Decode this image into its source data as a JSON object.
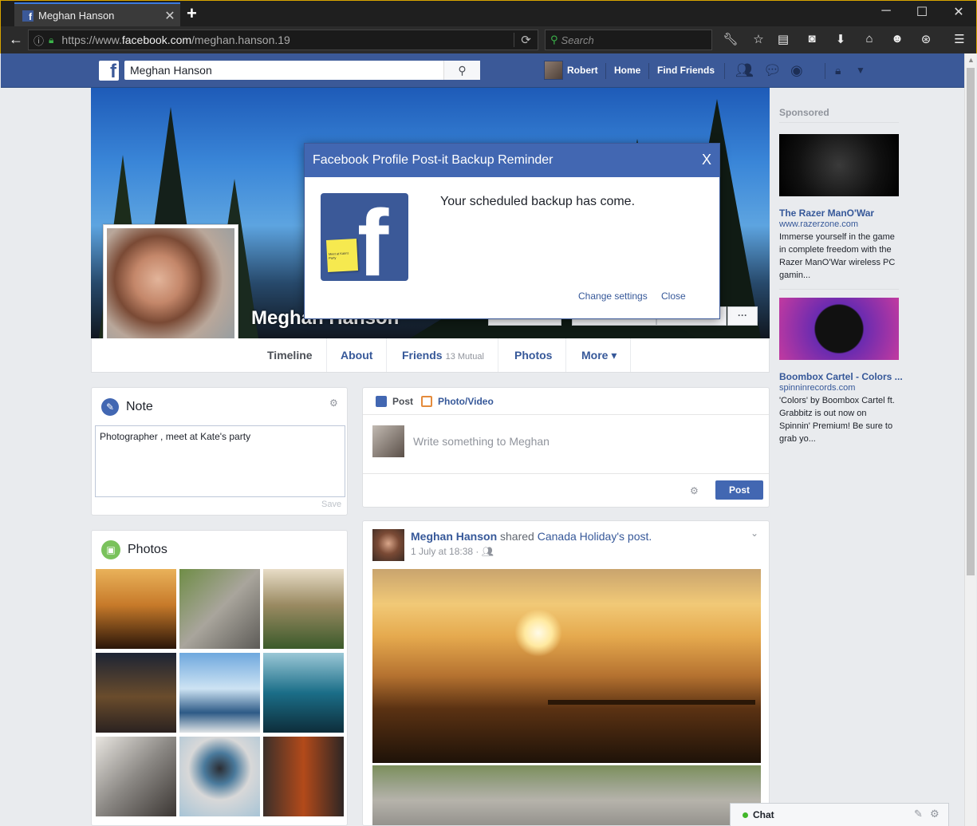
{
  "browser": {
    "tab_title": "Meghan Hanson",
    "new_tab_icon": "plus-icon",
    "url_prefix": "https://www.",
    "url_domain": "facebook.com",
    "url_path": "/meghan.hanson.19",
    "search_placeholder": "Search"
  },
  "fb": {
    "logo": "f",
    "search_value": "Meghan Hanson",
    "user_name": "Robert",
    "nav": [
      "Home",
      "Find Friends"
    ],
    "brand_color": "#3b5998"
  },
  "profile": {
    "name": "Meghan Hanson",
    "tabs": [
      {
        "label": "Timeline"
      },
      {
        "label": "About"
      },
      {
        "label": "Friends",
        "sub": "13 Mutual"
      },
      {
        "label": "Photos"
      },
      {
        "label": "More ▾"
      }
    ]
  },
  "note": {
    "title": "Note",
    "text": "Photographer , meet at Kate's party",
    "save": "Save"
  },
  "photos": {
    "title": "Photos"
  },
  "composer": {
    "tab_post": "Post",
    "tab_photo": "Photo/Video",
    "placeholder": "Write something to Meghan",
    "post_button": "Post"
  },
  "feed": {
    "author": "Meghan Hanson",
    "verb": "shared",
    "source": "Canada Holiday",
    "source_suffix": "'s",
    "object": "post.",
    "time": "1 July at 18:38 ·"
  },
  "sponsored": {
    "label": "Sponsored",
    "ads": [
      {
        "title": "The Razer ManO'War",
        "url": "www.razerzone.com",
        "text": "Immerse yourself in the game in complete freedom with the Razer ManO'War wireless PC gamin..."
      },
      {
        "title": "Boombox Cartel - Colors ...",
        "url": "spinninrecords.com",
        "text": "'Colors' by Boombox Cartel ft. Grabbitz is out now on Spinnin' Premium! Be sure to grab yo..."
      }
    ]
  },
  "chat": {
    "label": "Chat"
  },
  "modal": {
    "title": "Facebook Profile Post-it Backup Reminder",
    "close": "X",
    "message": "Your scheduled backup has come.",
    "postit_text": "Meet at Kate's Party",
    "change_settings": "Change settings",
    "close_link": "Close"
  }
}
